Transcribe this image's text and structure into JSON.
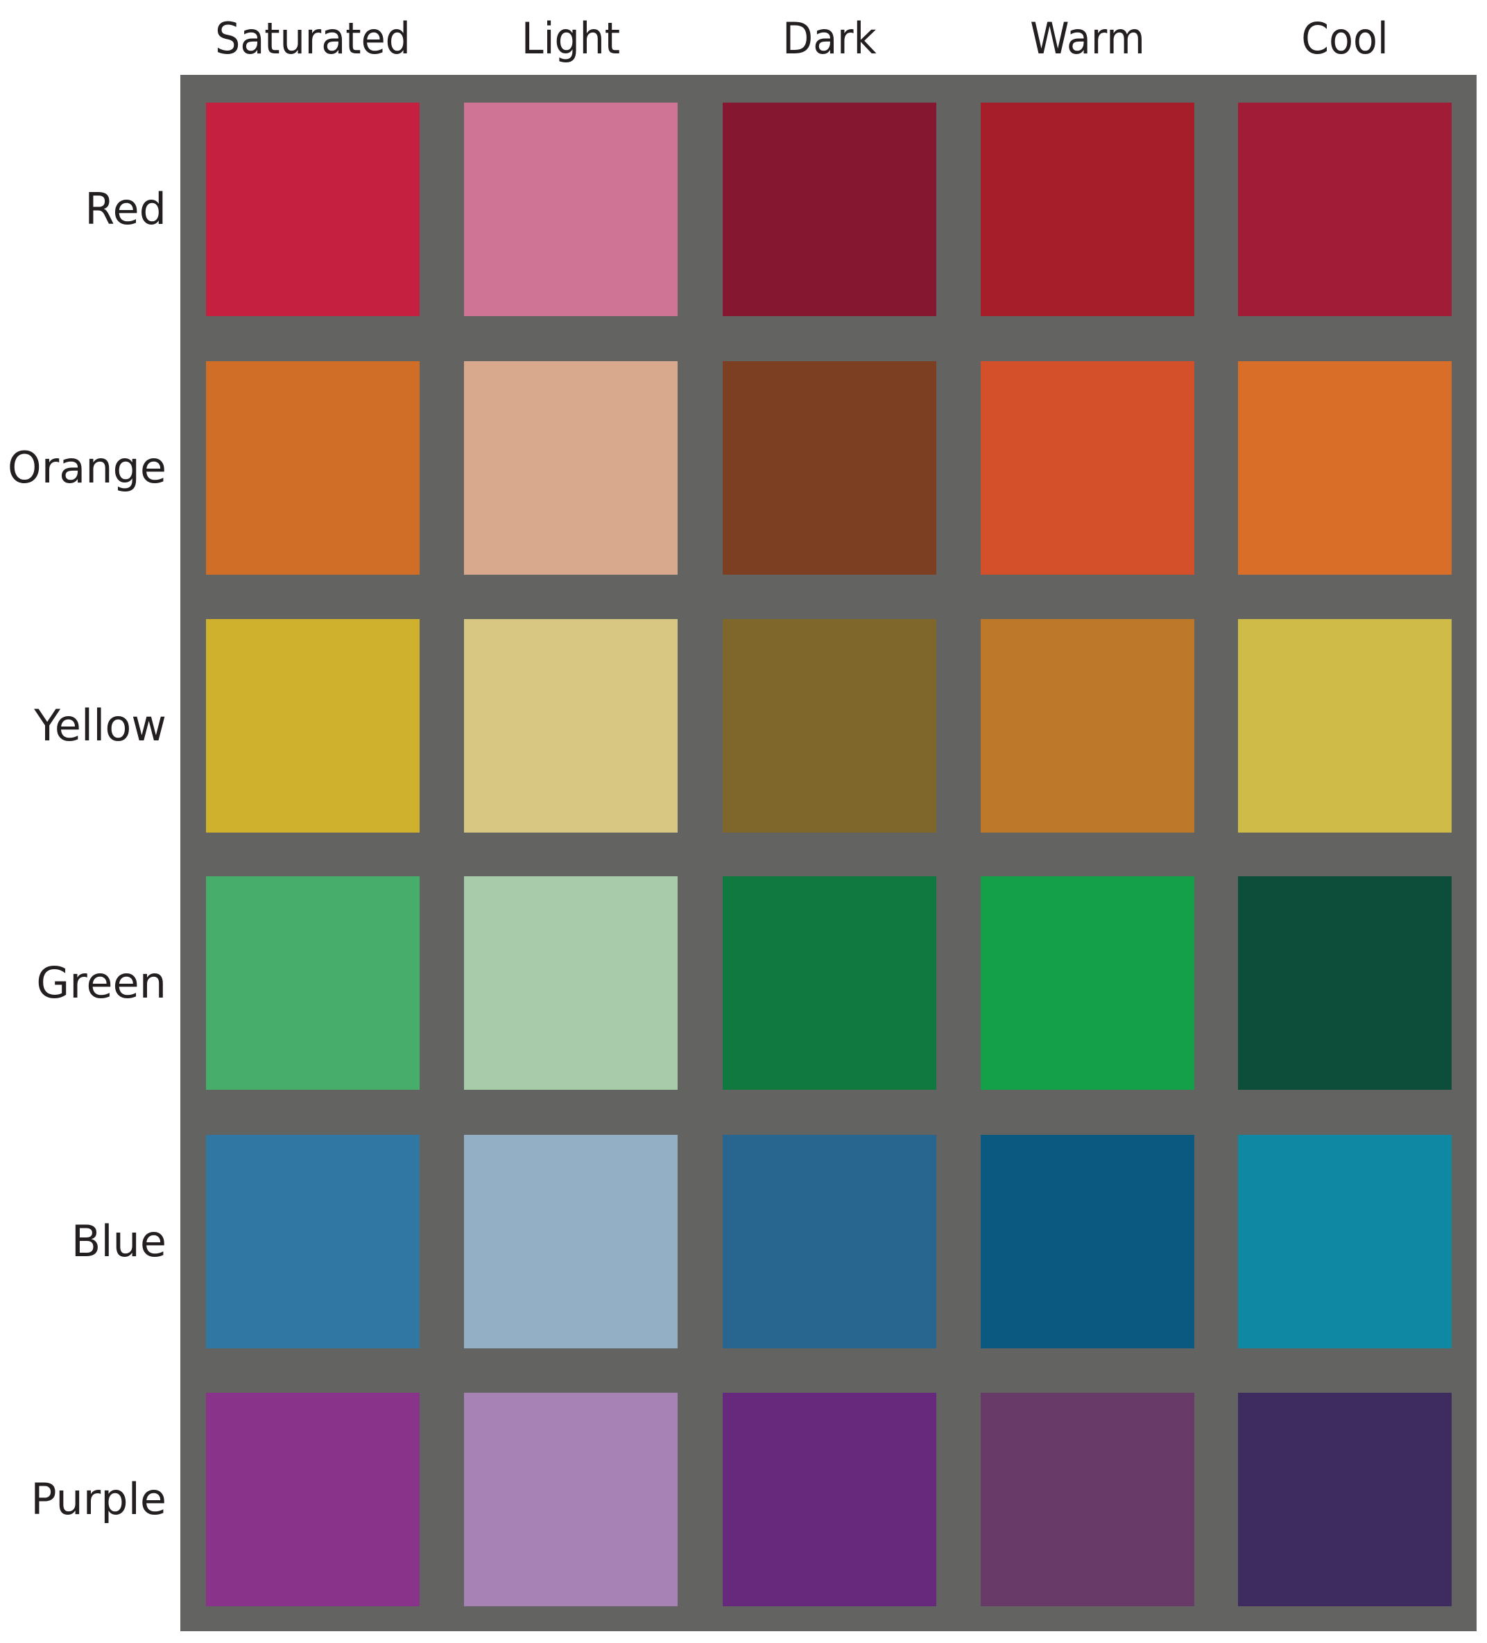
{
  "chart_data": {
    "type": "heatmap",
    "title": "",
    "columns": [
      "Saturated",
      "Light",
      "Dark",
      "Warm",
      "Cool"
    ],
    "rows": [
      "Red",
      "Orange",
      "Yellow",
      "Green",
      "Blue",
      "Purple"
    ],
    "colors": [
      [
        "#c52040",
        "#d07495",
        "#851730",
        "#a71e2b",
        "#a01c37"
      ],
      [
        "#d06e28",
        "#d8a98d",
        "#7d3f21",
        "#d3502a",
        "#d86e27"
      ],
      [
        "#cfb12d",
        "#d8c782",
        "#7f662a",
        "#be782a",
        "#cfbb47"
      ],
      [
        "#47ad6b",
        "#a8cba9",
        "#10793f",
        "#14a049",
        "#0c4e3a"
      ],
      [
        "#3077a3",
        "#93afc6",
        "#28658f",
        "#0b5881",
        "#0f88a4"
      ],
      [
        "#8a338a",
        "#a783b5",
        "#67297c",
        "#683a68",
        "#3e2c60"
      ]
    ],
    "background": "#636362"
  }
}
